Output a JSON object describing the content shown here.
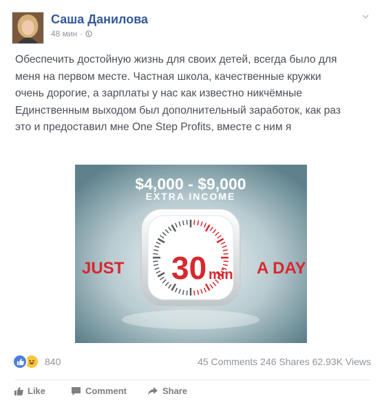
{
  "post": {
    "author": "Саша Данилова",
    "time": "48 мин",
    "separator": "·",
    "text_lines": [
      "Обеспечить достойную жизнь для своих детей, всегда было для",
      "меня на первом месте. Частная школа, качественные кружки",
      "очень дорогие, а зарплаты у нас как известно никчёмные",
      "Единственным выходом был дополнительный заработок, как раз",
      "это и предоставил мне One Step Profits, вместе с ним я"
    ]
  },
  "promo": {
    "headline": "$4,000 - $9,000",
    "subheadline": "EXTRA INCOME",
    "left_text": "JUST",
    "right_text": "A DAY",
    "center_number": "30",
    "center_unit": "min",
    "accent_color": "#d9272e",
    "background_color": "#6f8f99"
  },
  "reactions": {
    "icons": [
      "like-icon",
      "haha-icon"
    ],
    "count": "840"
  },
  "stats": {
    "comments": "45 Comments",
    "shares": "246 Shares",
    "views": "62.93K Views"
  },
  "actions": {
    "like": "Like",
    "comment": "Comment",
    "share": "Share"
  }
}
